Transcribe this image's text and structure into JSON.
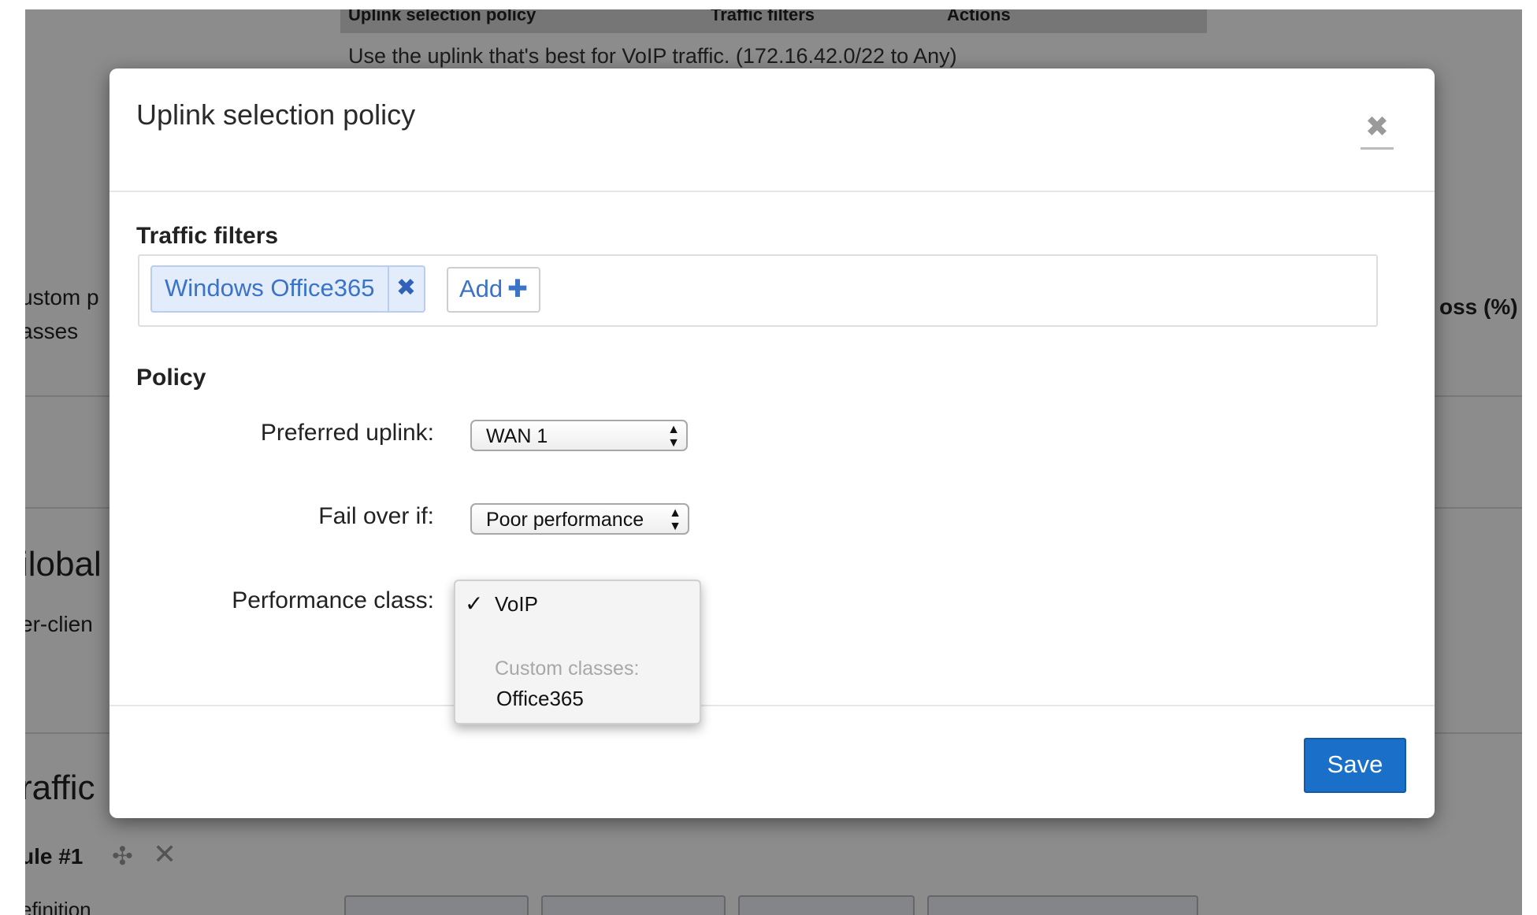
{
  "background": {
    "table_headers": [
      "Uplink selection policy",
      "Traffic filters",
      "Actions"
    ],
    "table_row": "Use the uplink that's best for VoIP traffic.   (172.16.42.0/22 to Any)",
    "left_fragments": [
      "ustom p",
      "asses",
      "ilobal",
      "er-clien",
      "raffic",
      "ule #1",
      "efinition"
    ],
    "right_fragment": "oss (%)"
  },
  "modal": {
    "title": "Uplink selection policy",
    "close_glyph": "✖",
    "traffic_filters_label": "Traffic filters",
    "filter_chip": "Windows Office365",
    "chip_remove_glyph": "✖",
    "add_button": "Add",
    "add_glyph": "✚",
    "policy_label": "Policy",
    "preferred_uplink": {
      "label": "Preferred uplink:",
      "value": "WAN 1"
    },
    "fail_over": {
      "label": "Fail over if:",
      "value": "Poor performance"
    },
    "performance_class": {
      "label": "Performance class:",
      "options": [
        {
          "label": "VoIP",
          "selected": true
        },
        {
          "group": "Custom classes:"
        },
        {
          "label": "Office365",
          "selected": false
        }
      ]
    },
    "save_button": "Save"
  },
  "colors": {
    "accent": "#1a6fc8",
    "chip_bg": "#e3ecfb",
    "chip_text": "#3a73c7"
  },
  "icons": [
    "close-icon",
    "remove-icon",
    "plus-icon",
    "select-arrows-icon",
    "checkmark-icon",
    "move-icon"
  ]
}
